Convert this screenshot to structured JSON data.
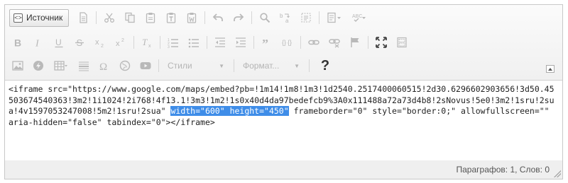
{
  "toolbar": {
    "source_label": "Источник",
    "styles_label": "Стили",
    "format_label": "Формат...",
    "help_label": "?"
  },
  "editor": {
    "before_selection": "<iframe src=\"https://www.google.com/maps/embed?pb=!1m14!1m8!1m3!1d2540.2517400060515!2d30.6296602903656!3d50.45503674540363!3m2!1i1024!2i768!4f13.1!3m3!1m2!1s0x40d4da97bedefcb9%3A0x111488a72a73d4b8!2sNovus!5e0!3m2!1sru!2sua!4v1597053247008!5m2!1sru!2sua\" ",
    "selection": "width=\"600\" height=\"450\"",
    "after_selection": " frameborder=\"0\" style=\"border:0;\" allowfullscreen=\"\" aria-hidden=\"false\" tabindex=\"0\"></iframe>"
  },
  "status": {
    "text": "Параграфов: 1, Слов: 0"
  },
  "colors": {
    "selection": "#3f8de8",
    "toolbar_bg": "#f4f4f4"
  }
}
